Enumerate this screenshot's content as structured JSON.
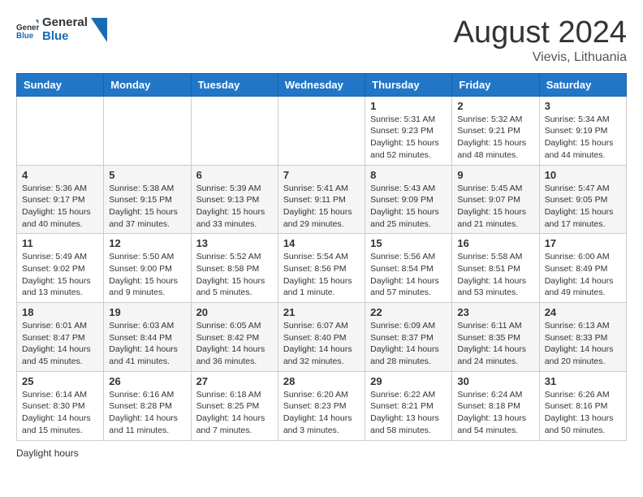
{
  "header": {
    "logo_general": "General",
    "logo_blue": "Blue",
    "month_year": "August 2024",
    "location": "Vievis, Lithuania"
  },
  "days_of_week": [
    "Sunday",
    "Monday",
    "Tuesday",
    "Wednesday",
    "Thursday",
    "Friday",
    "Saturday"
  ],
  "legend": {
    "label": "Daylight hours"
  },
  "weeks": [
    [
      {
        "day": "",
        "sunrise": "",
        "sunset": "",
        "daylight": ""
      },
      {
        "day": "",
        "sunrise": "",
        "sunset": "",
        "daylight": ""
      },
      {
        "day": "",
        "sunrise": "",
        "sunset": "",
        "daylight": ""
      },
      {
        "day": "",
        "sunrise": "",
        "sunset": "",
        "daylight": ""
      },
      {
        "day": "1",
        "sunrise": "Sunrise: 5:31 AM",
        "sunset": "Sunset: 9:23 PM",
        "daylight": "Daylight: 15 hours and 52 minutes."
      },
      {
        "day": "2",
        "sunrise": "Sunrise: 5:32 AM",
        "sunset": "Sunset: 9:21 PM",
        "daylight": "Daylight: 15 hours and 48 minutes."
      },
      {
        "day": "3",
        "sunrise": "Sunrise: 5:34 AM",
        "sunset": "Sunset: 9:19 PM",
        "daylight": "Daylight: 15 hours and 44 minutes."
      }
    ],
    [
      {
        "day": "4",
        "sunrise": "Sunrise: 5:36 AM",
        "sunset": "Sunset: 9:17 PM",
        "daylight": "Daylight: 15 hours and 40 minutes."
      },
      {
        "day": "5",
        "sunrise": "Sunrise: 5:38 AM",
        "sunset": "Sunset: 9:15 PM",
        "daylight": "Daylight: 15 hours and 37 minutes."
      },
      {
        "day": "6",
        "sunrise": "Sunrise: 5:39 AM",
        "sunset": "Sunset: 9:13 PM",
        "daylight": "Daylight: 15 hours and 33 minutes."
      },
      {
        "day": "7",
        "sunrise": "Sunrise: 5:41 AM",
        "sunset": "Sunset: 9:11 PM",
        "daylight": "Daylight: 15 hours and 29 minutes."
      },
      {
        "day": "8",
        "sunrise": "Sunrise: 5:43 AM",
        "sunset": "Sunset: 9:09 PM",
        "daylight": "Daylight: 15 hours and 25 minutes."
      },
      {
        "day": "9",
        "sunrise": "Sunrise: 5:45 AM",
        "sunset": "Sunset: 9:07 PM",
        "daylight": "Daylight: 15 hours and 21 minutes."
      },
      {
        "day": "10",
        "sunrise": "Sunrise: 5:47 AM",
        "sunset": "Sunset: 9:05 PM",
        "daylight": "Daylight: 15 hours and 17 minutes."
      }
    ],
    [
      {
        "day": "11",
        "sunrise": "Sunrise: 5:49 AM",
        "sunset": "Sunset: 9:02 PM",
        "daylight": "Daylight: 15 hours and 13 minutes."
      },
      {
        "day": "12",
        "sunrise": "Sunrise: 5:50 AM",
        "sunset": "Sunset: 9:00 PM",
        "daylight": "Daylight: 15 hours and 9 minutes."
      },
      {
        "day": "13",
        "sunrise": "Sunrise: 5:52 AM",
        "sunset": "Sunset: 8:58 PM",
        "daylight": "Daylight: 15 hours and 5 minutes."
      },
      {
        "day": "14",
        "sunrise": "Sunrise: 5:54 AM",
        "sunset": "Sunset: 8:56 PM",
        "daylight": "Daylight: 15 hours and 1 minute."
      },
      {
        "day": "15",
        "sunrise": "Sunrise: 5:56 AM",
        "sunset": "Sunset: 8:54 PM",
        "daylight": "Daylight: 14 hours and 57 minutes."
      },
      {
        "day": "16",
        "sunrise": "Sunrise: 5:58 AM",
        "sunset": "Sunset: 8:51 PM",
        "daylight": "Daylight: 14 hours and 53 minutes."
      },
      {
        "day": "17",
        "sunrise": "Sunrise: 6:00 AM",
        "sunset": "Sunset: 8:49 PM",
        "daylight": "Daylight: 14 hours and 49 minutes."
      }
    ],
    [
      {
        "day": "18",
        "sunrise": "Sunrise: 6:01 AM",
        "sunset": "Sunset: 8:47 PM",
        "daylight": "Daylight: 14 hours and 45 minutes."
      },
      {
        "day": "19",
        "sunrise": "Sunrise: 6:03 AM",
        "sunset": "Sunset: 8:44 PM",
        "daylight": "Daylight: 14 hours and 41 minutes."
      },
      {
        "day": "20",
        "sunrise": "Sunrise: 6:05 AM",
        "sunset": "Sunset: 8:42 PM",
        "daylight": "Daylight: 14 hours and 36 minutes."
      },
      {
        "day": "21",
        "sunrise": "Sunrise: 6:07 AM",
        "sunset": "Sunset: 8:40 PM",
        "daylight": "Daylight: 14 hours and 32 minutes."
      },
      {
        "day": "22",
        "sunrise": "Sunrise: 6:09 AM",
        "sunset": "Sunset: 8:37 PM",
        "daylight": "Daylight: 14 hours and 28 minutes."
      },
      {
        "day": "23",
        "sunrise": "Sunrise: 6:11 AM",
        "sunset": "Sunset: 8:35 PM",
        "daylight": "Daylight: 14 hours and 24 minutes."
      },
      {
        "day": "24",
        "sunrise": "Sunrise: 6:13 AM",
        "sunset": "Sunset: 8:33 PM",
        "daylight": "Daylight: 14 hours and 20 minutes."
      }
    ],
    [
      {
        "day": "25",
        "sunrise": "Sunrise: 6:14 AM",
        "sunset": "Sunset: 8:30 PM",
        "daylight": "Daylight: 14 hours and 15 minutes."
      },
      {
        "day": "26",
        "sunrise": "Sunrise: 6:16 AM",
        "sunset": "Sunset: 8:28 PM",
        "daylight": "Daylight: 14 hours and 11 minutes."
      },
      {
        "day": "27",
        "sunrise": "Sunrise: 6:18 AM",
        "sunset": "Sunset: 8:25 PM",
        "daylight": "Daylight: 14 hours and 7 minutes."
      },
      {
        "day": "28",
        "sunrise": "Sunrise: 6:20 AM",
        "sunset": "Sunset: 8:23 PM",
        "daylight": "Daylight: 14 hours and 3 minutes."
      },
      {
        "day": "29",
        "sunrise": "Sunrise: 6:22 AM",
        "sunset": "Sunset: 8:21 PM",
        "daylight": "Daylight: 13 hours and 58 minutes."
      },
      {
        "day": "30",
        "sunrise": "Sunrise: 6:24 AM",
        "sunset": "Sunset: 8:18 PM",
        "daylight": "Daylight: 13 hours and 54 minutes."
      },
      {
        "day": "31",
        "sunrise": "Sunrise: 6:26 AM",
        "sunset": "Sunset: 8:16 PM",
        "daylight": "Daylight: 13 hours and 50 minutes."
      }
    ]
  ]
}
